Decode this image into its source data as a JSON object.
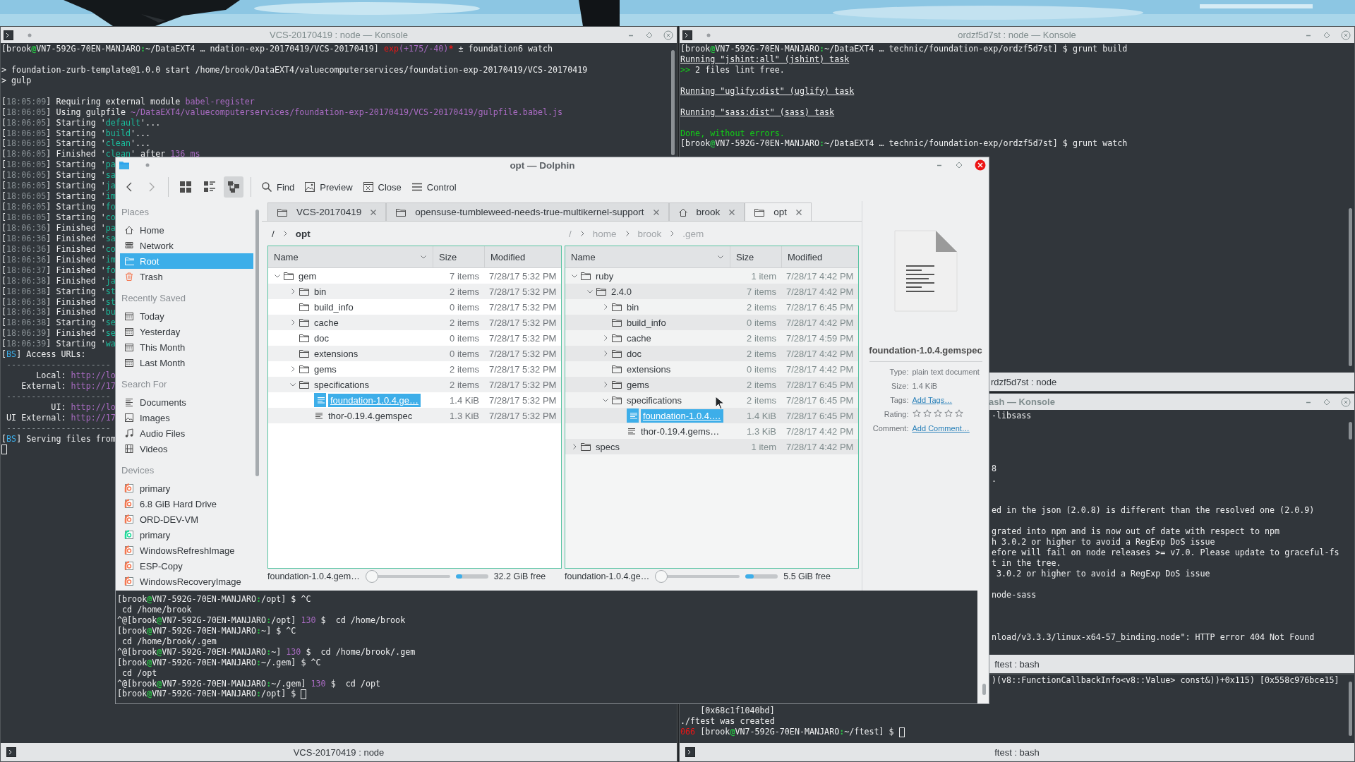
{
  "konsoles": [
    {
      "title": "VCS-20170419 : node — Konsole",
      "tab": "VCS-20170419 : node",
      "lines": [
        {
          "kind": "text",
          "spans": [
            {
              "text": "[brook"
            },
            {
              "text": "@",
              "color": "#27c043"
            },
            {
              "text": "VN7-592G-70EN-MANJARO"
            },
            {
              "text": ":",
              "color": "#27c043"
            },
            {
              "text": "~/DataEXT4 … ndation-exp-20170419/VCS-20170419] "
            },
            {
              "text": "exp",
              "color": "#ed1515"
            },
            {
              "text": "(+175/-40)",
              "color": "#a96bc2"
            },
            {
              "text": "*",
              "color": "#ed1515"
            },
            {
              "text": " ± foundation6 watch"
            }
          ]
        },
        {
          "kind": "blank"
        },
        {
          "kind": "text",
          "spans": [
            {
              "text": "> foundation-zurb-template@1.0.0 start /home/brook/DataEXT4/valuecomputerservices/foundation-exp-20170419/VCS-20170419"
            }
          ]
        },
        {
          "kind": "text",
          "spans": [
            {
              "text": "> gulp"
            }
          ]
        },
        {
          "kind": "blank"
        },
        {
          "kind": "text",
          "spans": [
            {
              "text": "["
            },
            {
              "text": "18:05:09",
              "color": "#8a9296"
            },
            {
              "text": "] Requiring external module "
            },
            {
              "text": "babel-register",
              "color": "#a96bc2"
            }
          ]
        },
        {
          "kind": "text",
          "spans": [
            {
              "text": "["
            },
            {
              "text": "18:06:05",
              "color": "#8a9296"
            },
            {
              "text": "] Using gulpfile "
            },
            {
              "text": "~/DataEXT4/valuecomputerservices/foundation-exp-20170419/VCS-20170419/gulpfile.babel.js",
              "color": "#a96bc2"
            }
          ]
        },
        {
          "kind": "text",
          "spans": [
            {
              "text": "["
            },
            {
              "text": "18:06:05",
              "color": "#8a9296"
            },
            {
              "text": "] Starting '"
            },
            {
              "text": "default",
              "color": "#1abc9c"
            },
            {
              "text": "'..."
            }
          ]
        },
        {
          "kind": "text",
          "spans": [
            {
              "text": "["
            },
            {
              "text": "18:06:05",
              "color": "#8a9296"
            },
            {
              "text": "] Starting '"
            },
            {
              "text": "build",
              "color": "#1abc9c"
            },
            {
              "text": "'..."
            }
          ]
        },
        {
          "kind": "text",
          "spans": [
            {
              "text": "["
            },
            {
              "text": "18:06:05",
              "color": "#8a9296"
            },
            {
              "text": "] Starting '"
            },
            {
              "text": "clean",
              "color": "#1abc9c"
            },
            {
              "text": "'..."
            }
          ]
        },
        {
          "kind": "text",
          "spans": [
            {
              "text": "["
            },
            {
              "text": "18:06:05",
              "color": "#8a9296"
            },
            {
              "text": "] Finished '"
            },
            {
              "text": "clean",
              "color": "#1abc9c"
            },
            {
              "text": "' after "
            },
            {
              "text": "136 ms",
              "color": "#a96bc2"
            }
          ]
        },
        {
          "kind": "text",
          "spans": [
            {
              "text": "["
            },
            {
              "text": "18:06:05",
              "color": "#8a9296"
            },
            {
              "text": "] Starting '"
            },
            {
              "text": "pa",
              "color": "#1abc9c"
            }
          ]
        },
        {
          "kind": "text",
          "spans": [
            {
              "text": "["
            },
            {
              "text": "18:06:05",
              "color": "#8a9296"
            },
            {
              "text": "] Starting '"
            },
            {
              "text": "sa",
              "color": "#1abc9c"
            }
          ]
        },
        {
          "kind": "text",
          "spans": [
            {
              "text": "["
            },
            {
              "text": "18:06:05",
              "color": "#8a9296"
            },
            {
              "text": "] Starting '"
            },
            {
              "text": "ja",
              "color": "#1abc9c"
            }
          ]
        },
        {
          "kind": "text",
          "spans": [
            {
              "text": "["
            },
            {
              "text": "18:06:05",
              "color": "#8a9296"
            },
            {
              "text": "] Starting '"
            },
            {
              "text": "im",
              "color": "#1abc9c"
            }
          ]
        },
        {
          "kind": "text",
          "spans": [
            {
              "text": "["
            },
            {
              "text": "18:06:05",
              "color": "#8a9296"
            },
            {
              "text": "] Starting '"
            },
            {
              "text": "fo",
              "color": "#1abc9c"
            }
          ]
        },
        {
          "kind": "text",
          "spans": [
            {
              "text": "["
            },
            {
              "text": "18:06:05",
              "color": "#8a9296"
            },
            {
              "text": "] Starting '"
            },
            {
              "text": "co",
              "color": "#1abc9c"
            }
          ]
        },
        {
          "kind": "text",
          "spans": [
            {
              "text": "["
            },
            {
              "text": "18:06:36",
              "color": "#8a9296"
            },
            {
              "text": "] Finished '"
            },
            {
              "text": "pa",
              "color": "#1abc9c"
            }
          ]
        },
        {
          "kind": "text",
          "spans": [
            {
              "text": "["
            },
            {
              "text": "18:06:36",
              "color": "#8a9296"
            },
            {
              "text": "] Finished '"
            },
            {
              "text": "sa",
              "color": "#1abc9c"
            }
          ]
        },
        {
          "kind": "text",
          "spans": [
            {
              "text": "["
            },
            {
              "text": "18:06:36",
              "color": "#8a9296"
            },
            {
              "text": "] Finished '"
            },
            {
              "text": "co",
              "color": "#1abc9c"
            }
          ]
        },
        {
          "kind": "text",
          "spans": [
            {
              "text": "["
            },
            {
              "text": "18:06:36",
              "color": "#8a9296"
            },
            {
              "text": "] Finished '"
            },
            {
              "text": "im",
              "color": "#1abc9c"
            }
          ]
        },
        {
          "kind": "text",
          "spans": [
            {
              "text": "["
            },
            {
              "text": "18:06:37",
              "color": "#8a9296"
            },
            {
              "text": "] Finished '"
            },
            {
              "text": "fo",
              "color": "#1abc9c"
            }
          ]
        },
        {
          "kind": "text",
          "spans": [
            {
              "text": "["
            },
            {
              "text": "18:06:38",
              "color": "#8a9296"
            },
            {
              "text": "] Finished '"
            },
            {
              "text": "ja",
              "color": "#1abc9c"
            }
          ]
        },
        {
          "kind": "text",
          "spans": [
            {
              "text": "["
            },
            {
              "text": "18:06:38",
              "color": "#8a9296"
            },
            {
              "text": "] Starting '"
            },
            {
              "text": "st",
              "color": "#1abc9c"
            }
          ]
        },
        {
          "kind": "text",
          "spans": [
            {
              "text": "["
            },
            {
              "text": "18:06:38",
              "color": "#8a9296"
            },
            {
              "text": "] Finished '"
            },
            {
              "text": "st",
              "color": "#1abc9c"
            }
          ]
        },
        {
          "kind": "text",
          "spans": [
            {
              "text": "["
            },
            {
              "text": "18:06:38",
              "color": "#8a9296"
            },
            {
              "text": "] Finished '"
            },
            {
              "text": "bu",
              "color": "#1abc9c"
            }
          ]
        },
        {
          "kind": "text",
          "spans": [
            {
              "text": "["
            },
            {
              "text": "18:06:38",
              "color": "#8a9296"
            },
            {
              "text": "] Starting '"
            },
            {
              "text": "se",
              "color": "#1abc9c"
            }
          ]
        },
        {
          "kind": "text",
          "spans": [
            {
              "text": "["
            },
            {
              "text": "18:06:39",
              "color": "#8a9296"
            },
            {
              "text": "] Finished '"
            },
            {
              "text": "se",
              "color": "#1abc9c"
            }
          ]
        },
        {
          "kind": "text",
          "spans": [
            {
              "text": "["
            },
            {
              "text": "18:06:39",
              "color": "#8a9296"
            },
            {
              "text": "] Starting '"
            },
            {
              "text": "wa",
              "color": "#1abc9c"
            }
          ]
        },
        {
          "kind": "text",
          "spans": [
            {
              "text": "["
            },
            {
              "text": "BS",
              "color": "#3daee9"
            },
            {
              "text": "] Access URLs:"
            }
          ]
        },
        {
          "kind": "text",
          "spans": [
            {
              "text": " ---------------------",
              "color": "#8a9296"
            }
          ]
        },
        {
          "kind": "text",
          "spans": [
            {
              "text": "       Local: "
            },
            {
              "text": "http://lo",
              "color": "#a96bc2"
            }
          ]
        },
        {
          "kind": "text",
          "spans": [
            {
              "text": "    External: "
            },
            {
              "text": "http://17",
              "color": "#a96bc2"
            }
          ]
        },
        {
          "kind": "text",
          "spans": [
            {
              "text": " ---------------------",
              "color": "#8a9296"
            }
          ]
        },
        {
          "kind": "text",
          "spans": [
            {
              "text": "          UI: "
            },
            {
              "text": "http://lo",
              "color": "#a96bc2"
            }
          ]
        },
        {
          "kind": "text",
          "spans": [
            {
              "text": " UI External: "
            },
            {
              "text": "http://17",
              "color": "#a96bc2"
            }
          ]
        },
        {
          "kind": "text",
          "spans": [
            {
              "text": " ---------------------",
              "color": "#8a9296"
            }
          ]
        },
        {
          "kind": "text",
          "spans": [
            {
              "text": "["
            },
            {
              "text": "BS",
              "color": "#3daee9"
            },
            {
              "text": "] Serving files from"
            }
          ]
        },
        {
          "kind": "cursor"
        }
      ]
    },
    {
      "title": "ordzf5d7st : node — Konsole",
      "tab": "rdzf5d7st : node",
      "lines": [
        {
          "kind": "text",
          "spans": [
            {
              "text": "[brook"
            },
            {
              "text": "@",
              "color": "#27c043"
            },
            {
              "text": "VN7-592G-70EN-MANJARO"
            },
            {
              "text": ":",
              "color": "#27c043"
            },
            {
              "text": "~/DataEXT4 … technic/foundation-exp/ordzf5d7st] $ grunt build"
            }
          ]
        },
        {
          "kind": "text",
          "spans": [
            {
              "text": "Running \"jshint:all\" (jshint) task",
              "underline": true
            }
          ]
        },
        {
          "kind": "text",
          "spans": [
            {
              "text": ">>",
              "color": "#11d116"
            },
            {
              "text": " 2 files lint free."
            }
          ]
        },
        {
          "kind": "blank"
        },
        {
          "kind": "text",
          "spans": [
            {
              "text": "Running \"uglify:dist\" (uglify) task",
              "underline": true
            }
          ]
        },
        {
          "kind": "blank"
        },
        {
          "kind": "text",
          "spans": [
            {
              "text": "Running \"sass:dist\" (sass) task",
              "underline": true
            }
          ]
        },
        {
          "kind": "blank"
        },
        {
          "kind": "text",
          "spans": [
            {
              "text": "Done, without errors.",
              "color": "#11d116"
            }
          ]
        },
        {
          "kind": "text",
          "spans": [
            {
              "text": "[brook"
            },
            {
              "text": "@",
              "color": "#27c043"
            },
            {
              "text": "VN7-592G-70EN-MANJARO"
            },
            {
              "text": ":",
              "color": "#27c043"
            },
            {
              "text": "~/DataEXT4 … technic/foundation-exp/ordzf5d7st] $ grunt watch"
            }
          ]
        }
      ]
    },
    {
      "title": "ash — Konsole",
      "tab": "ftest : bash",
      "lines": [
        {
          "kind": "text",
          "spans": [
            {
              "text": "-libsass"
            }
          ]
        },
        {
          "kind": "blank"
        },
        {
          "kind": "blank"
        },
        {
          "kind": "blank"
        },
        {
          "kind": "blank"
        },
        {
          "kind": "text",
          "spans": [
            {
              "text": "8"
            }
          ]
        },
        {
          "kind": "text",
          "spans": [
            {
              "text": "."
            }
          ]
        },
        {
          "kind": "blank"
        },
        {
          "kind": "blank"
        },
        {
          "kind": "text",
          "spans": [
            {
              "text": "ed in the json (2.0.8) is different than the resolved one (2.0.9)"
            }
          ]
        },
        {
          "kind": "blank"
        },
        {
          "kind": "text",
          "spans": [
            {
              "text": "grated into npm and is now out of date with respect to npm"
            }
          ]
        },
        {
          "kind": "text",
          "spans": [
            {
              "text": "h 3.0.2 or higher to avoid a RegExp DoS issue"
            }
          ]
        },
        {
          "kind": "text",
          "spans": [
            {
              "text": "efore will fail on node releases >= v7.0. Please update to graceful-fs"
            }
          ]
        },
        {
          "kind": "text",
          "spans": [
            {
              "text": "t in the tree."
            }
          ]
        },
        {
          "kind": "text",
          "spans": [
            {
              "text": " 3.0.2 or higher to avoid a RegExp DoS issue"
            }
          ]
        },
        {
          "kind": "blank"
        },
        {
          "kind": "text",
          "spans": [
            {
              "text": "node-sass"
            }
          ]
        },
        {
          "kind": "blank"
        },
        {
          "kind": "blank"
        },
        {
          "kind": "blank"
        },
        {
          "kind": "text",
          "spans": [
            {
              "text": "nload/v3.3.3/linux-x64-57_binding.node\": HTTP error 404 Not Found"
            }
          ]
        }
      ]
    },
    {
      "tab": "ftest : bash",
      "lines": [
        {
          "kind": "text",
          "spans": [
            {
              "text": ")(v8::FunctionCallbackInfo<v8::Value> const&))+0x115) [0x558c976bce15]"
            }
          ]
        }
      ],
      "lines_below": [
        {
          "kind": "text",
          "spans": [
            {
              "text": "    [0x68c1f1040bd]"
            }
          ]
        },
        {
          "kind": "text",
          "spans": [
            {
              "text": "./ftest was created"
            }
          ]
        },
        {
          "kind": "cursor",
          "spans": [
            {
              "text": "066",
              "color": "#ed1515"
            },
            {
              "text": " [brook"
            },
            {
              "text": "@",
              "color": "#27c043"
            },
            {
              "text": "VN7-592G-70EN-MANJARO"
            },
            {
              "text": ":",
              "color": "#27c043"
            },
            {
              "text": "~/ftest] $ "
            }
          ]
        }
      ]
    }
  ],
  "dolphin": {
    "title": "opt — Dolphin",
    "navigation": [
      {
        "disabled": false
      },
      {
        "disabled": true
      }
    ],
    "view_modes": [
      {
        "selected": false
      },
      {
        "selected": false
      },
      {
        "selected": true
      }
    ],
    "actions": [
      {
        "label": "Find"
      },
      {
        "label": "Preview"
      },
      {
        "label": "Close"
      },
      {
        "label": "Control"
      }
    ],
    "places": [
      {
        "heading": "Places",
        "items": [
          {
            "label": "Home",
            "selected": false
          },
          {
            "label": "Network",
            "selected": false
          },
          {
            "label": "Root",
            "selected": true
          },
          {
            "label": "Trash",
            "selected": false
          }
        ]
      },
      {
        "heading": "Recently Saved",
        "items": [
          {
            "label": "Today",
            "selected": false
          },
          {
            "label": "Yesterday",
            "selected": false
          },
          {
            "label": "This Month",
            "selected": false
          },
          {
            "label": "Last Month",
            "selected": false
          }
        ]
      },
      {
        "heading": "Search For",
        "items": [
          {
            "label": "Documents",
            "selected": false
          },
          {
            "label": "Images",
            "selected": false
          },
          {
            "label": "Audio Files",
            "selected": false
          },
          {
            "label": "Videos",
            "selected": false
          }
        ]
      },
      {
        "heading": "Devices",
        "items": [
          {
            "label": "primary",
            "selected": false,
            "color": "#f47750"
          },
          {
            "label": "6.8 GiB Hard Drive",
            "selected": false,
            "color": "#f47750"
          },
          {
            "label": "ORD-DEV-VM",
            "selected": false,
            "color": "#f47750"
          },
          {
            "label": "primary",
            "selected": false,
            "color": "#1cdc9a"
          },
          {
            "label": "WindowsRefreshImage",
            "selected": false,
            "color": "#f47750"
          },
          {
            "label": "ESP-Copy",
            "selected": false,
            "color": "#f47750"
          },
          {
            "label": "WindowsRecoveryImage",
            "selected": false,
            "color": "#f47750"
          }
        ]
      }
    ],
    "tabs": [
      {
        "label": "VCS-20170419",
        "kind": "folder",
        "selected": false
      },
      {
        "label": "opensuse-tumbleweed-needs-true-multikernel-support",
        "kind": "folder",
        "selected": false
      },
      {
        "label": "brook",
        "kind": "home",
        "selected": false
      },
      {
        "label": "opt",
        "kind": "folder",
        "selected": true
      }
    ],
    "panes": [
      {
        "active": true,
        "breadcrumb": [
          "/",
          "opt"
        ],
        "columns": [
          "Name",
          "Size",
          "Modified"
        ],
        "rows": [
          {
            "name": "gem",
            "kind": "folder",
            "has_children": true,
            "expanded": true,
            "selected": false,
            "size": "7 items",
            "modified": "7/28/17 5:32 PM",
            "children": [
              {
                "name": "bin",
                "kind": "folder",
                "has_children": true,
                "expanded": false,
                "selected": false,
                "size": "2 items",
                "modified": "7/28/17 5:32 PM"
              },
              {
                "name": "build_info",
                "kind": "folder",
                "has_children": false,
                "selected": false,
                "size": "0 items",
                "modified": "7/28/17 5:32 PM"
              },
              {
                "name": "cache",
                "kind": "folder",
                "has_children": true,
                "expanded": false,
                "selected": false,
                "size": "2 items",
                "modified": "7/28/17 5:32 PM"
              },
              {
                "name": "doc",
                "kind": "folder",
                "has_children": false,
                "selected": false,
                "size": "0 items",
                "modified": "7/28/17 5:32 PM"
              },
              {
                "name": "extensions",
                "kind": "folder",
                "has_children": false,
                "selected": false,
                "size": "0 items",
                "modified": "7/28/17 5:32 PM"
              },
              {
                "name": "gems",
                "kind": "folder",
                "has_children": true,
                "expanded": false,
                "selected": false,
                "size": "2 items",
                "modified": "7/28/17 5:32 PM"
              },
              {
                "name": "specifications",
                "kind": "folder",
                "has_children": true,
                "expanded": true,
                "selected": false,
                "size": "2 items",
                "modified": "7/28/17 5:32 PM",
                "children": [
                  {
                    "name": "foundation-1.0.4.ge…",
                    "kind": "file",
                    "has_children": false,
                    "selected": true,
                    "size": "1.4 KiB",
                    "modified": "7/28/17 5:32 PM"
                  },
                  {
                    "name": "thor-0.19.4.gemspec",
                    "kind": "file",
                    "has_children": false,
                    "selected": false,
                    "size": "1.3 KiB",
                    "modified": "7/28/17 5:32 PM"
                  }
                ]
              }
            ]
          }
        ],
        "status": {
          "file": "foundation-1.0.4.gem…",
          "zoom": {
            "level": 0
          },
          "space": {
            "level": 0.2
          },
          "free": "32.2 GiB free"
        }
      },
      {
        "active": false,
        "breadcrumb": [
          "/",
          "home",
          "brook",
          ".gem"
        ],
        "columns": [
          "Name",
          "Size",
          "Modified"
        ],
        "rows": [
          {
            "name": "ruby",
            "kind": "folder",
            "has_children": true,
            "expanded": true,
            "selected": false,
            "size": "1 item",
            "modified": "7/28/17 4:42 PM",
            "children": [
              {
                "name": "2.4.0",
                "kind": "folder",
                "has_children": true,
                "expanded": true,
                "selected": false,
                "size": "7 items",
                "modified": "7/28/17 4:42 PM",
                "children": [
                  {
                    "name": "bin",
                    "kind": "folder",
                    "has_children": true,
                    "expanded": false,
                    "selected": false,
                    "size": "2 items",
                    "modified": "7/28/17 6:45 PM"
                  },
                  {
                    "name": "build_info",
                    "kind": "folder",
                    "has_children": false,
                    "selected": false,
                    "size": "0 items",
                    "modified": "7/28/17 4:42 PM"
                  },
                  {
                    "name": "cache",
                    "kind": "folder",
                    "has_children": true,
                    "expanded": false,
                    "selected": false,
                    "size": "2 items",
                    "modified": "7/28/17 4:59 PM"
                  },
                  {
                    "name": "doc",
                    "kind": "folder",
                    "has_children": true,
                    "expanded": false,
                    "selected": false,
                    "size": "2 items",
                    "modified": "7/28/17 4:42 PM"
                  },
                  {
                    "name": "extensions",
                    "kind": "folder",
                    "has_children": false,
                    "selected": false,
                    "size": "0 items",
                    "modified": "7/28/17 4:42 PM"
                  },
                  {
                    "name": "gems",
                    "kind": "folder",
                    "has_children": true,
                    "expanded": false,
                    "selected": false,
                    "size": "2 items",
                    "modified": "7/28/17 6:45 PM"
                  },
                  {
                    "name": "specifications",
                    "kind": "folder",
                    "has_children": true,
                    "expanded": true,
                    "selected": false,
                    "size": "2 items",
                    "modified": "7/28/17 6:45 PM",
                    "children": [
                      {
                        "name": "foundation-1.0.4.…",
                        "kind": "file",
                        "has_children": false,
                        "selected": true,
                        "size": "1.4 KiB",
                        "modified": "7/28/17 6:45 PM"
                      },
                      {
                        "name": "thor-0.19.4.gems…",
                        "kind": "file",
                        "has_children": false,
                        "selected": false,
                        "size": "1.3 KiB",
                        "modified": "7/28/17 4:42 PM"
                      }
                    ]
                  }
                ]
              }
            ]
          },
          {
            "name": "specs",
            "kind": "folder",
            "has_children": true,
            "expanded": false,
            "selected": false,
            "size": "1 item",
            "modified": "7/28/17 4:42 PM"
          }
        ],
        "status": {
          "file": "foundation-1.0.4.ge…",
          "zoom": {
            "level": 0
          },
          "space": {
            "level": 0.25
          },
          "free": "5.5 GiB free"
        }
      }
    ],
    "info": {
      "name": "foundation-1.0.4.gemspec",
      "fields": [
        {
          "kind": "text",
          "label": "Type:",
          "value": "plain text document"
        },
        {
          "kind": "text",
          "label": "Size:",
          "value": "1.4 KiB"
        },
        {
          "kind": "link",
          "label": "Tags:",
          "value": "Add Tags…"
        },
        {
          "kind": "rating",
          "label": "Rating:",
          "stars": 0
        },
        {
          "kind": "link",
          "label": "Comment:",
          "value": "Add Comment…"
        }
      ]
    },
    "terminal": {
      "lines": [
        {
          "kind": "text",
          "spans": [
            {
              "text": "[brook"
            },
            {
              "text": "@",
              "color": "#27c043"
            },
            {
              "text": "VN7-592G-70EN-MANJARO"
            },
            {
              "text": ":",
              "color": "#27c043"
            },
            {
              "text": "/opt] $ ^C"
            }
          ]
        },
        {
          "kind": "text",
          "spans": [
            {
              "text": " cd /home/brook"
            }
          ]
        },
        {
          "kind": "text",
          "spans": [
            {
              "text": "^@[brook"
            },
            {
              "text": "@",
              "color": "#27c043"
            },
            {
              "text": "VN7-592G-70EN-MANJARO"
            },
            {
              "text": ":",
              "color": "#27c043"
            },
            {
              "text": "/opt] "
            },
            {
              "text": "130",
              "color": "#a96bc2"
            },
            {
              "text": " $  cd /home/brook"
            }
          ]
        },
        {
          "kind": "text",
          "spans": [
            {
              "text": "[brook"
            },
            {
              "text": "@",
              "color": "#27c043"
            },
            {
              "text": "VN7-592G-70EN-MANJARO"
            },
            {
              "text": ":",
              "color": "#27c043"
            },
            {
              "text": "~] $ ^C"
            }
          ]
        },
        {
          "kind": "text",
          "spans": [
            {
              "text": " cd /home/brook/.gem"
            }
          ]
        },
        {
          "kind": "text",
          "spans": [
            {
              "text": "^@[brook"
            },
            {
              "text": "@",
              "color": "#27c043"
            },
            {
              "text": "VN7-592G-70EN-MANJARO"
            },
            {
              "text": ":",
              "color": "#27c043"
            },
            {
              "text": "~] "
            },
            {
              "text": "130",
              "color": "#a96bc2"
            },
            {
              "text": " $  cd /home/brook/.gem"
            }
          ]
        },
        {
          "kind": "text",
          "spans": [
            {
              "text": "[brook"
            },
            {
              "text": "@",
              "color": "#27c043"
            },
            {
              "text": "VN7-592G-70EN-MANJARO"
            },
            {
              "text": ":",
              "color": "#27c043"
            },
            {
              "text": "~/.gem] $ ^C"
            }
          ]
        },
        {
          "kind": "text",
          "spans": [
            {
              "text": " cd /opt"
            }
          ]
        },
        {
          "kind": "text",
          "spans": [
            {
              "text": "^@[brook"
            },
            {
              "text": "@",
              "color": "#27c043"
            },
            {
              "text": "VN7-592G-70EN-MANJARO"
            },
            {
              "text": ":",
              "color": "#27c043"
            },
            {
              "text": "~/.gem] "
            },
            {
              "text": "130",
              "color": "#a96bc2"
            },
            {
              "text": " $  cd /opt"
            }
          ]
        },
        {
          "kind": "cursor",
          "spans": [
            {
              "text": "[brook"
            },
            {
              "text": "@",
              "color": "#27c043"
            },
            {
              "text": "VN7-592G-70EN-MANJARO"
            },
            {
              "text": ":",
              "color": "#27c043"
            },
            {
              "text": "/opt] $ "
            }
          ]
        }
      ]
    }
  }
}
